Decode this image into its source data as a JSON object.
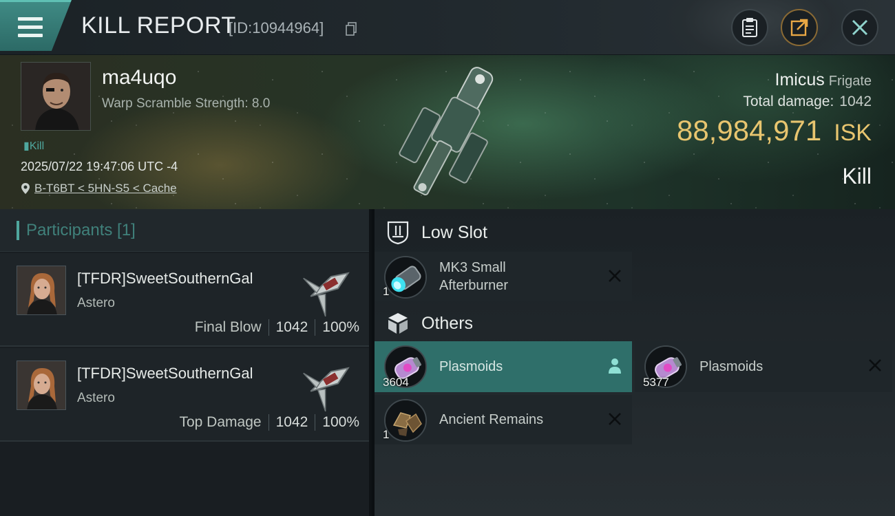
{
  "header": {
    "title": "KILL REPORT",
    "report_id": "[ID:10944964]"
  },
  "banner": {
    "pilot_name": "ma4uqo",
    "warp_scramble": "Warp Scramble Strength: 8.0",
    "kill_tag": "Kill",
    "datetime": "2025/07/22 19:47:06 UTC -4",
    "location": "B-T6BT < 5HN-S5 < Cache",
    "ship_name": "Imicus",
    "ship_class": "Frigate",
    "total_damage_label": "Total damage:",
    "total_damage_value": "1042",
    "isk_value": "88,984,971",
    "isk_unit": "ISK",
    "kill_type": "Kill"
  },
  "participants": {
    "title": "Participants [1]",
    "cards": [
      {
        "name": "[TFDR]SweetSouthernGal",
        "ship": "Astero",
        "label": "Final Blow",
        "damage": "1042",
        "percent": "100%"
      },
      {
        "name": "[TFDR]SweetSouthernGal",
        "ship": "Astero",
        "label": "Top Damage",
        "damage": "1042",
        "percent": "100%"
      }
    ]
  },
  "sections": {
    "low_slot": "Low Slot",
    "others": "Others"
  },
  "items": {
    "afterburner": {
      "name_line1": "MK3 Small",
      "name_line2": "Afterburner",
      "qty": "1"
    },
    "plasmoids_a": {
      "name": "Plasmoids",
      "qty": "3604"
    },
    "plasmoids_b": {
      "name": "Plasmoids",
      "qty": "5377"
    },
    "ancient_remains": {
      "name": "Ancient Remains",
      "qty": "1"
    }
  },
  "colors": {
    "accent": "#4fa79e",
    "isk": "#e8c56f",
    "highlight": "#2f6f6a"
  }
}
